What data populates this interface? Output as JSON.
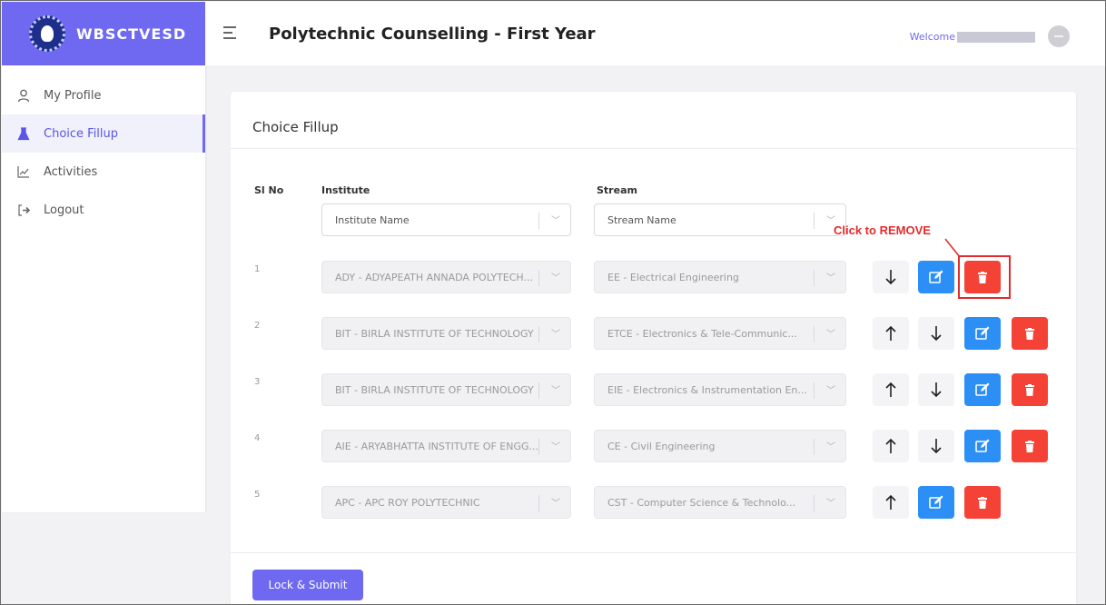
{
  "brand": {
    "name": "WBSCTVESD"
  },
  "header": {
    "title": "Polytechnic Counselling - First Year",
    "welcome_label": "Welcome"
  },
  "sidebar": {
    "items": [
      {
        "label": "My Profile",
        "icon": "user-icon",
        "active": false
      },
      {
        "label": "Choice Fillup",
        "icon": "flask-icon",
        "active": true
      },
      {
        "label": "Activities",
        "icon": "chart-line-icon",
        "active": false
      },
      {
        "label": "Logout",
        "icon": "logout-icon",
        "active": false
      }
    ]
  },
  "card": {
    "title": "Choice Fillup",
    "columns": {
      "sl": "Sl No",
      "institute": "Institute",
      "stream": "Stream"
    },
    "filters": {
      "institute_placeholder": "Institute Name",
      "stream_placeholder": "Stream Name"
    },
    "rows": [
      {
        "sl": "1",
        "institute": "ADY - ADYAPEATH ANNADA POLYTECH...",
        "stream": "EE - Electrical Engineering"
      },
      {
        "sl": "2",
        "institute": "BIT - BIRLA INSTITUTE OF TECHNOLOGY",
        "stream": "ETCE - Electronics & Tele-Communic..."
      },
      {
        "sl": "3",
        "institute": "BIT - BIRLA INSTITUTE OF TECHNOLOGY",
        "stream": "EIE - Electronics & Instrumentation En..."
      },
      {
        "sl": "4",
        "institute": "AIE - ARYABHATTA INSTITUTE OF ENGG...",
        "stream": "CE - Civil Engineering"
      },
      {
        "sl": "5",
        "institute": "APC - APC ROY POLYTECHNIC",
        "stream": "CST - Computer Science & Technolo..."
      }
    ],
    "submit_label": "Lock & Submit"
  },
  "annotation": {
    "text": "Click to REMOVE",
    "color": "#e32b2b"
  },
  "colors": {
    "accent": "#6f69f1",
    "edit": "#2b8ff6",
    "delete": "#f44336"
  }
}
